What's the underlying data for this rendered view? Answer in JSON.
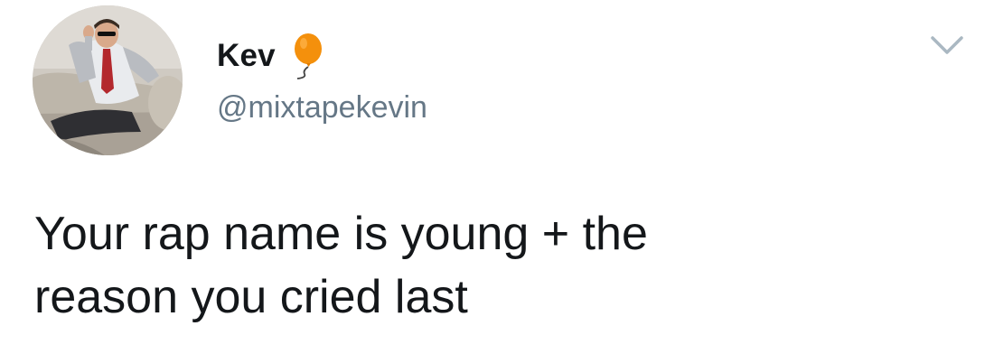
{
  "tweet": {
    "author": {
      "display_name": "Kev",
      "handle": "@mixtapekevin",
      "name_emoji": "balloon-icon",
      "avatar": "avatar-photo"
    },
    "menu_icon": "chevron-down-icon",
    "text_line_1": "Your rap name is young + the",
    "text_line_2": "reason you cried last"
  },
  "colors": {
    "name": "#14171a",
    "handle": "#657786",
    "chevron": "#aab8c2",
    "balloon": "#f4900c",
    "background": "#ffffff"
  }
}
